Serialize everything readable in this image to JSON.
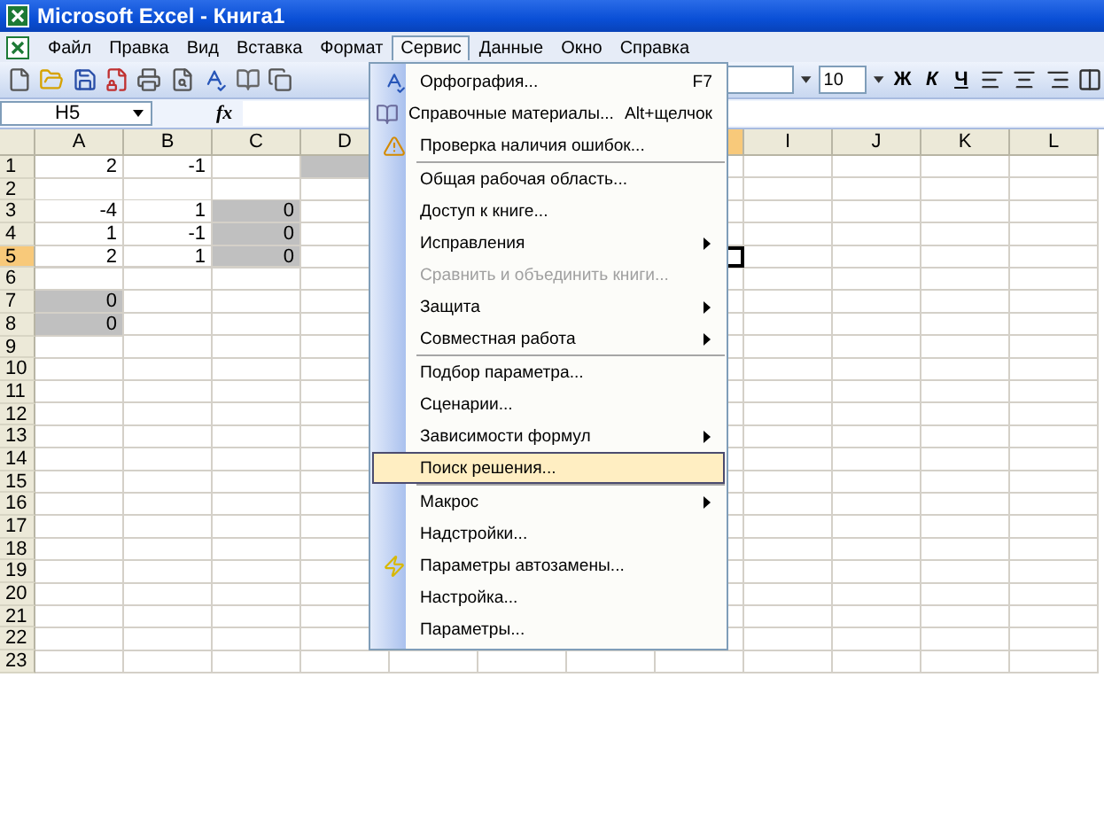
{
  "window": {
    "title": "Microsoft Excel - Книга1"
  },
  "menu_bar": [
    {
      "label": "Файл",
      "selected": false
    },
    {
      "label": "Правка",
      "selected": false
    },
    {
      "label": "Вид",
      "selected": false
    },
    {
      "label": "Вставка",
      "selected": false
    },
    {
      "label": "Формат",
      "selected": false
    },
    {
      "label": "Сервис",
      "selected": true
    },
    {
      "label": "Данные",
      "selected": false
    },
    {
      "label": "Окно",
      "selected": false
    },
    {
      "label": "Справка",
      "selected": false
    }
  ],
  "toolbar": {
    "font_size": "10",
    "bold": "Ж",
    "italic": "К",
    "underline": "Ч"
  },
  "formula_bar": {
    "name_box": "H5",
    "fx": "fx"
  },
  "columns": [
    {
      "label": "A",
      "selected": false
    },
    {
      "label": "B",
      "selected": false
    },
    {
      "label": "C",
      "selected": false
    },
    {
      "label": "D",
      "selected": false
    },
    {},
    {},
    {},
    {
      "selected": true
    },
    {
      "label": "I",
      "selected": false
    },
    {
      "label": "J",
      "selected": false
    },
    {
      "label": "K",
      "selected": false
    },
    {
      "label": "L",
      "selected": false
    }
  ],
  "rows": [
    {
      "label": "1",
      "selected": false,
      "cells": [
        {
          "value": "2",
          "shaded": false
        },
        {
          "value": "-1",
          "shaded": false
        },
        {
          "shaded": false
        },
        {
          "shaded": true
        }
      ]
    },
    {
      "label": "2",
      "selected": false
    },
    {
      "label": "3",
      "selected": false,
      "cells": [
        {
          "value": "-4",
          "shaded": false
        },
        {
          "value": "1",
          "shaded": false
        },
        {
          "value": "0",
          "shaded": true
        }
      ]
    },
    {
      "label": "4",
      "selected": false,
      "cells": [
        {
          "value": "1",
          "shaded": false
        },
        {
          "value": "-1",
          "shaded": false
        },
        {
          "value": "0",
          "shaded": true
        }
      ]
    },
    {
      "label": "5",
      "selected": true,
      "cells": [
        {
          "value": "2",
          "shaded": false
        },
        {
          "value": "1",
          "shaded": false
        },
        {
          "value": "0",
          "shaded": true
        }
      ]
    },
    {
      "label": "6",
      "selected": false
    },
    {
      "label": "7",
      "selected": false,
      "cells": [
        {
          "value": "0",
          "shaded": true
        }
      ]
    },
    {
      "label": "8",
      "selected": false,
      "cells": [
        {
          "value": "0",
          "shaded": true
        }
      ]
    },
    {
      "label": "9",
      "selected": false
    },
    {
      "label": "10",
      "selected": false
    },
    {
      "label": "11",
      "selected": false
    },
    {
      "label": "12",
      "selected": false
    },
    {
      "label": "13",
      "selected": false
    },
    {
      "label": "14",
      "selected": false
    },
    {
      "label": "15",
      "selected": false
    },
    {
      "label": "16",
      "selected": false
    },
    {
      "label": "17",
      "selected": false
    },
    {
      "label": "18",
      "selected": false
    },
    {
      "label": "19",
      "selected": false
    },
    {
      "label": "20",
      "selected": false
    },
    {
      "label": "21",
      "selected": false
    },
    {
      "label": "22",
      "selected": false
    },
    {
      "label": "23",
      "selected": false
    }
  ],
  "dropdown_menu": [
    {
      "kind": "item",
      "label": "Орфография...",
      "shortcut": "F7",
      "submenu": false,
      "disabled": false,
      "selected": false
    },
    {
      "kind": "item",
      "label": "Справочные материалы...",
      "shortcut": "Alt+щелчок",
      "submenu": false,
      "disabled": false,
      "selected": false
    },
    {
      "kind": "item",
      "label": "Проверка наличия ошибок...",
      "submenu": false,
      "disabled": false,
      "selected": false
    },
    {
      "kind": "separator"
    },
    {
      "kind": "item",
      "label": "Общая рабочая область...",
      "submenu": false,
      "disabled": false,
      "selected": false
    },
    {
      "kind": "item",
      "label": "Доступ к книге...",
      "submenu": false,
      "disabled": false,
      "selected": false
    },
    {
      "kind": "item",
      "label": "Исправления",
      "submenu": true,
      "disabled": false,
      "selected": false
    },
    {
      "kind": "item",
      "label": "Сравнить и объединить книги...",
      "submenu": false,
      "disabled": true,
      "selected": false
    },
    {
      "kind": "item",
      "label": "Защита",
      "submenu": true,
      "disabled": false,
      "selected": false
    },
    {
      "kind": "item",
      "label": "Совместная работа",
      "submenu": true,
      "disabled": false,
      "selected": false
    },
    {
      "kind": "separator"
    },
    {
      "kind": "item",
      "label": "Подбор параметра...",
      "submenu": false,
      "disabled": false,
      "selected": false
    },
    {
      "kind": "item",
      "label": "Сценарии...",
      "submenu": false,
      "disabled": false,
      "selected": false
    },
    {
      "kind": "item",
      "label": "Зависимости формул",
      "submenu": true,
      "disabled": false,
      "selected": false
    },
    {
      "kind": "item",
      "label": "Поиск решения...",
      "submenu": false,
      "disabled": false,
      "selected": true
    },
    {
      "kind": "separator"
    },
    {
      "kind": "item",
      "label": "Макрос",
      "submenu": true,
      "disabled": false,
      "selected": false
    },
    {
      "kind": "item",
      "label": "Надстройки...",
      "submenu": false,
      "disabled": false,
      "selected": false
    },
    {
      "kind": "item",
      "label": "Параметры автозамены...",
      "submenu": false,
      "disabled": false,
      "selected": false
    },
    {
      "kind": "item",
      "label": "Настройка...",
      "submenu": false,
      "disabled": false,
      "selected": false
    },
    {
      "kind": "item",
      "label": "Параметры...",
      "submenu": false,
      "disabled": false,
      "selected": false
    }
  ]
}
